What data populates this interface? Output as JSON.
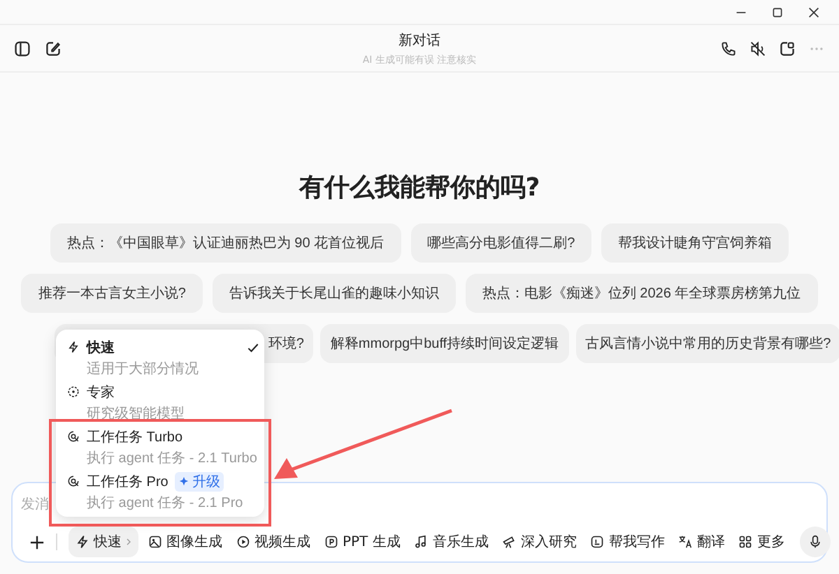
{
  "window": {
    "title": "新对话",
    "subtitle": "AI 生成可能有误 注意核实"
  },
  "heading": "有什么我能帮你的吗?",
  "suggestion_rows": [
    [
      "热点：《中国眼草》认证迪丽热巴为 90 花首位视后",
      "哪些高分电影值得二刷?",
      "帮我设计睫角守宫饲养箱"
    ],
    [
      "推荐一本古言女主小说?",
      "告诉我关于长尾山雀的趣味小知识",
      "热点：电影《痴迷》位列 2026 年全球票房榜第九位"
    ],
    [
      "环境?",
      "解释mmorpg中buff持续时间设定逻辑",
      "古风言情小说中常用的历史背景有哪些?"
    ]
  ],
  "mode_menu": [
    {
      "title": "快速",
      "subtitle": "适用于大部分情况",
      "selected": true,
      "kind": "fast"
    },
    {
      "title": "专家",
      "subtitle": "研究级智能模型",
      "selected": false,
      "kind": "expert"
    },
    {
      "title": "工作任务 Turbo",
      "subtitle": "执行 agent 任务 - 2.1 Turbo",
      "selected": false,
      "kind": "agent"
    },
    {
      "title": "工作任务 Pro",
      "badge": "升级",
      "subtitle": "执行 agent 任务 - 2.1 Pro",
      "selected": false,
      "kind": "agent"
    }
  ],
  "input": {
    "placeholder": "发消"
  },
  "toolbar": [
    {
      "label": "快速",
      "kind": "mode"
    },
    {
      "label": "图像生成",
      "kind": "image"
    },
    {
      "label": "视频生成",
      "kind": "video"
    },
    {
      "label": "PPT 生成",
      "kind": "ppt"
    },
    {
      "label": "音乐生成",
      "kind": "music"
    },
    {
      "label": "深入研究",
      "kind": "research"
    },
    {
      "label": "帮我写作",
      "kind": "write"
    },
    {
      "label": "翻译",
      "kind": "translate"
    },
    {
      "label": "更多",
      "kind": "more"
    }
  ]
}
